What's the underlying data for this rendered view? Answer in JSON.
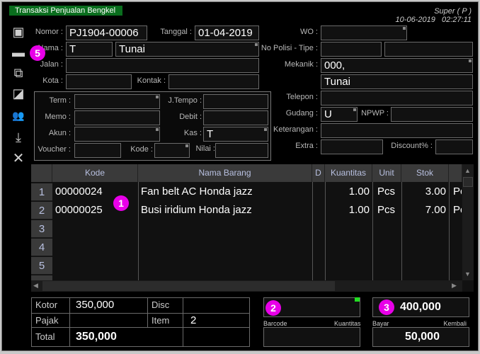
{
  "window": {
    "title": "Transaksi Penjualan Bengkel",
    "user": "Super ( P )",
    "datetime": "10-06-2019   02:27:11",
    "accent": "#0a6e1e"
  },
  "toolbar": [
    {
      "icon": "save-icon",
      "glyph": "▣"
    },
    {
      "icon": "print-icon",
      "glyph": "▬"
    },
    {
      "icon": "copy-icon",
      "glyph": "⧉"
    },
    {
      "icon": "squares-icon",
      "glyph": "◪"
    },
    {
      "icon": "users-icon",
      "glyph": "👥"
    },
    {
      "icon": "download-icon",
      "glyph": "⤓"
    },
    {
      "icon": "close-icon",
      "glyph": "✕"
    }
  ],
  "form": {
    "nomor": {
      "label": "Nomor :",
      "value": "PJ1904-00006"
    },
    "tanggal": {
      "label": "Tanggal :",
      "value": "01-04-2019"
    },
    "nama": {
      "label": "Nama :",
      "code": "T",
      "value": "Tunai"
    },
    "jalan": {
      "label": "Jalan :",
      "value": ""
    },
    "kota": {
      "label": "Kota :",
      "value": ""
    },
    "kontak": {
      "label": "Kontak :",
      "value": ""
    },
    "term": {
      "label": "Term :",
      "value": ""
    },
    "jtempo": {
      "label": "J.Tempo :",
      "value": ""
    },
    "memo": {
      "label": "Memo :",
      "value": ""
    },
    "debit": {
      "label": "Debit :",
      "value": ""
    },
    "akun": {
      "label": "Akun :",
      "value": ""
    },
    "kas": {
      "label": "Kas :",
      "value": "T"
    },
    "voucher": {
      "label": "Voucher :",
      "value": ""
    },
    "kode": {
      "label": "Kode :",
      "value": ""
    },
    "nilai": {
      "label": "Nilai :",
      "value": ""
    },
    "wo": {
      "label": "WO :",
      "value": ""
    },
    "nopolisi": {
      "label": "No Polisi - Tipe :",
      "value": "",
      "tipe": ""
    },
    "mekanik": {
      "label": "Mekanik :",
      "value": "000,",
      "value2": "Tunai"
    },
    "telepon": {
      "label": "Telepon :",
      "value": ""
    },
    "gudang": {
      "label": "Gudang :",
      "value": "U"
    },
    "npwp": {
      "label": "NPWP :",
      "value": ""
    },
    "keterangan": {
      "label": "Keterangan :",
      "value": ""
    },
    "extra": {
      "label": "Extra :",
      "value": ""
    },
    "discount": {
      "label": "Discount% :",
      "value": ""
    }
  },
  "grid": {
    "columns": [
      "Kode",
      "Nama Barang",
      "D",
      "Kuantitas",
      "Unit",
      "Stok",
      ""
    ],
    "row_numbers": [
      "1",
      "2",
      "3",
      "4",
      "5"
    ],
    "rows": [
      {
        "kode": "00000024",
        "nama": "Fan belt AC Honda jazz",
        "d": "",
        "qty": "1.00",
        "unit": "Pcs",
        "stok": "3.00",
        "extra": "Pc"
      },
      {
        "kode": "00000025",
        "nama": "Busi iridium Honda jazz",
        "d": "",
        "qty": "1.00",
        "unit": "Pcs",
        "stok": "7.00",
        "extra": "Pc"
      }
    ]
  },
  "summary": {
    "kotor_label": "Kotor",
    "kotor": "350,000",
    "disc_label": "Disc",
    "disc": "",
    "pajak_label": "Pajak",
    "pajak": "",
    "item_label": "Item",
    "item": "2",
    "total_label": "Total",
    "total": "350,000"
  },
  "entry": {
    "barcode_label": "Barcode",
    "kuantitas_label": "Kuantitas",
    "barcode": "",
    "bayar_label": "Bayar",
    "kembali_label": "Kembali",
    "bayar": "400,000",
    "kembali": "50,000",
    "indicator_color": "#22dd22"
  },
  "badges": [
    "5",
    "1",
    "2",
    "3"
  ],
  "badge_color": "#e800e8"
}
